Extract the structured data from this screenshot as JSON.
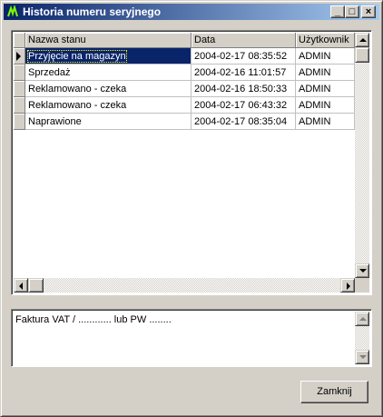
{
  "window": {
    "title": "Historia numeru seryjnego",
    "minimize": "_",
    "maximize": "□",
    "close": "×"
  },
  "grid": {
    "columns": [
      "Nazwa stanu",
      "Data",
      "Użytkownik"
    ],
    "rows": [
      {
        "status": "Przyjęcie na magazyn",
        "date": "2004-02-17 08:35:52",
        "user": "ADMIN"
      },
      {
        "status": "Sprzedaż",
        "date": "2004-02-16 11:01:57",
        "user": "ADMIN"
      },
      {
        "status": "Reklamowano - czeka",
        "date": "2004-02-16 18:50:33",
        "user": "ADMIN"
      },
      {
        "status": "Reklamowano - czeka",
        "date": "2004-02-17 06:43:32",
        "user": "ADMIN"
      },
      {
        "status": "Naprawione",
        "date": "2004-02-17 08:35:04",
        "user": "ADMIN"
      }
    ],
    "selected_row": 0
  },
  "memo": {
    "text": "Faktura VAT / ............ lub  PW ........"
  },
  "buttons": {
    "close_label": "Zamknij"
  },
  "colors": {
    "titlebar_start": "#0a246a",
    "titlebar_end": "#a6caf0",
    "selection": "#0a246a",
    "face": "#d4d0c8"
  }
}
